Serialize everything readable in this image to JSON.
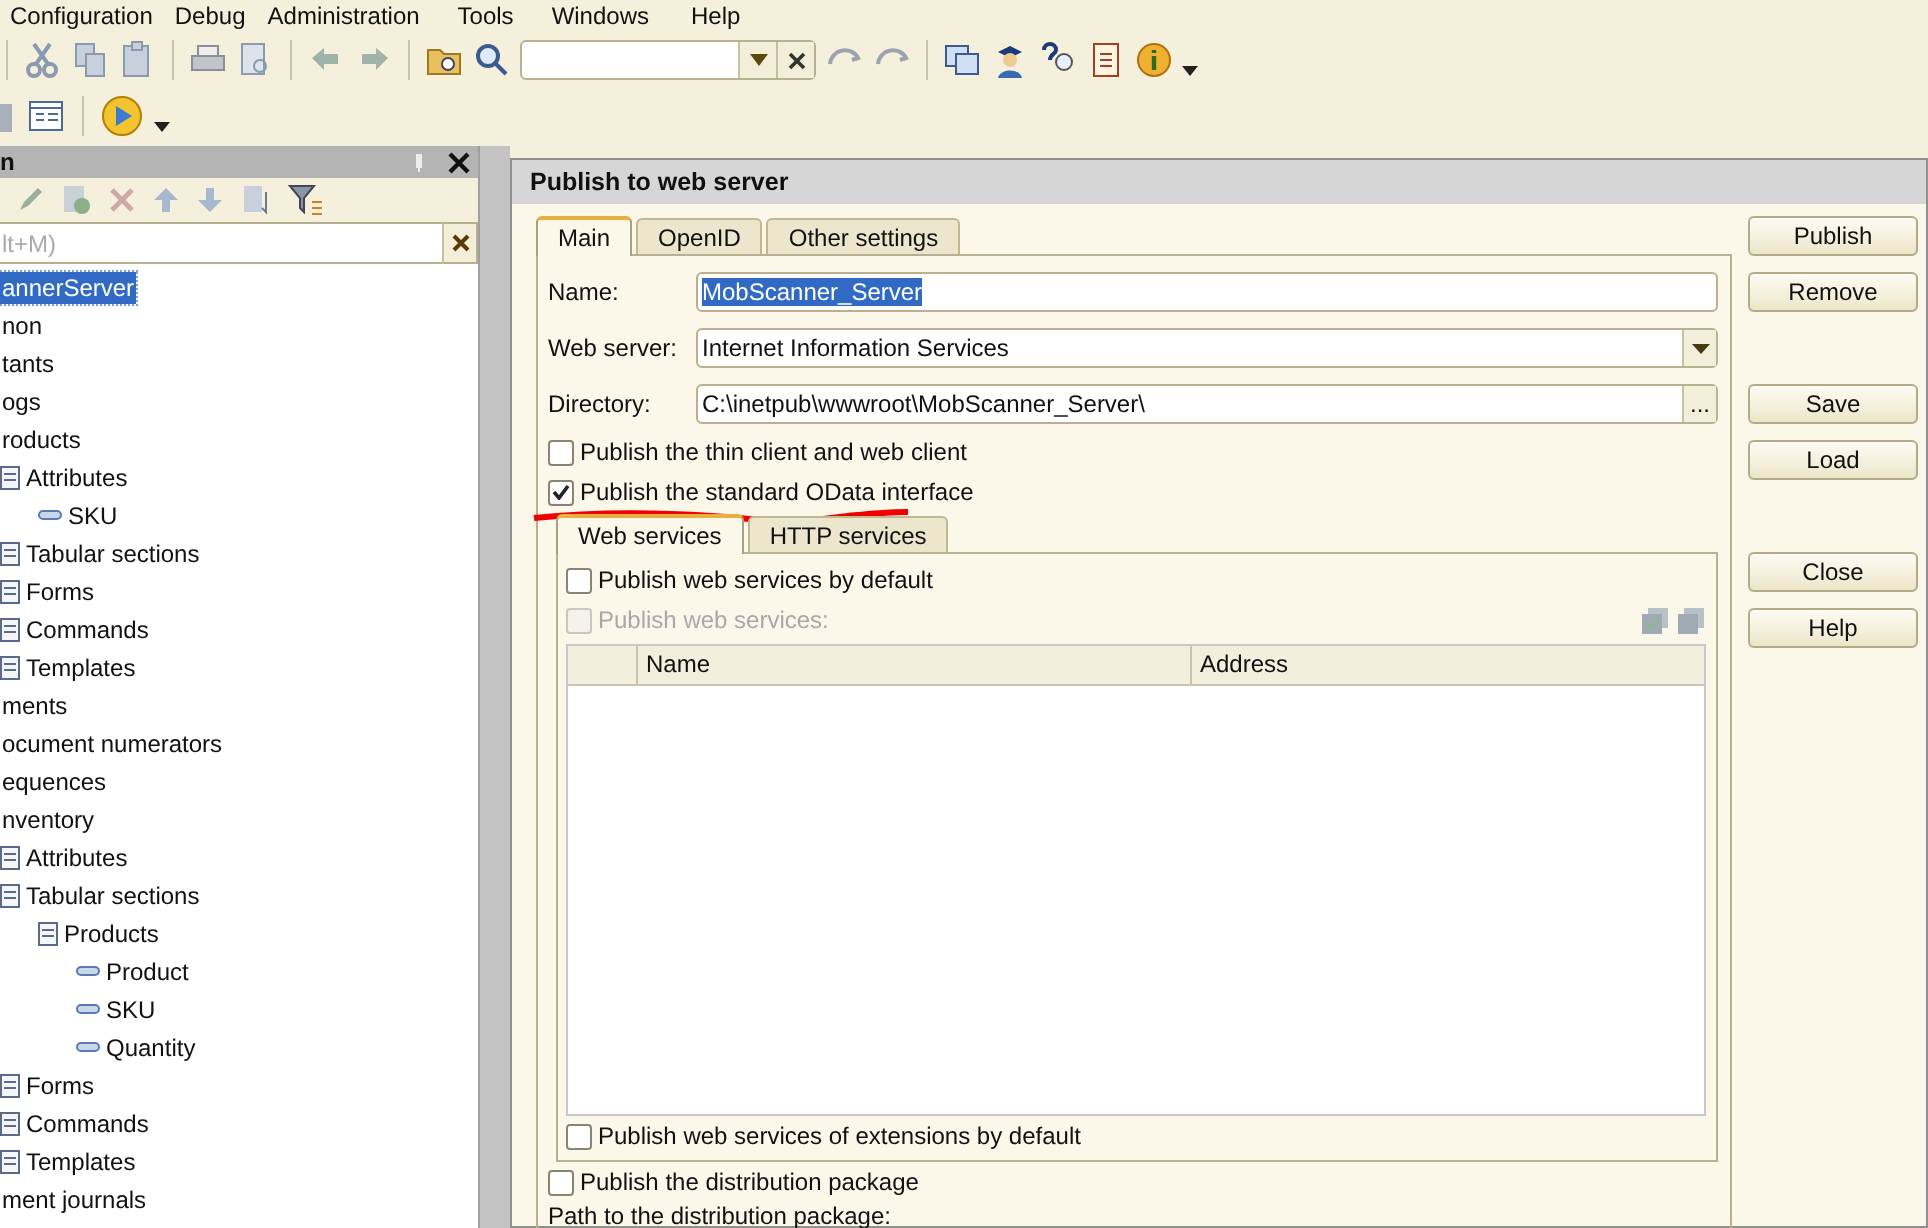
{
  "menu": [
    {
      "label": "Configuration"
    },
    {
      "label": "Debug"
    },
    {
      "label": "Administration"
    },
    {
      "label": "Tools"
    },
    {
      "label": "Windows"
    },
    {
      "label": "Help"
    }
  ],
  "panel": {
    "title": "n",
    "search_placeholder": "lt+M)",
    "tree": [
      {
        "label": "annerServer",
        "selected": true
      },
      {
        "label": "non",
        "selected": false
      },
      {
        "label": "tants",
        "selected": false
      },
      {
        "label": "ogs",
        "selected": false
      },
      {
        "label": "roducts",
        "selected": false,
        "children": [
          {
            "label": "Attributes",
            "selected": false,
            "children": [
              {
                "label": "SKU",
                "selected": false
              }
            ]
          },
          {
            "label": "Tabular sections",
            "selected": false
          },
          {
            "label": "Forms",
            "selected": false
          },
          {
            "label": "Commands",
            "selected": false
          },
          {
            "label": "Templates",
            "selected": false
          }
        ]
      },
      {
        "label": "ments",
        "selected": false
      },
      {
        "label": "ocument numerators",
        "selected": false
      },
      {
        "label": "equences",
        "selected": false
      },
      {
        "label": "nventory",
        "selected": false,
        "children": [
          {
            "label": "Attributes",
            "selected": false
          },
          {
            "label": "Tabular sections",
            "selected": false,
            "children": [
              {
                "label": "Products",
                "selected": false,
                "children": [
                  {
                    "label": "Product",
                    "selected": false
                  },
                  {
                    "label": "SKU",
                    "selected": false
                  },
                  {
                    "label": "Quantity",
                    "selected": false
                  }
                ]
              }
            ]
          },
          {
            "label": "Forms",
            "selected": false
          },
          {
            "label": "Commands",
            "selected": false
          },
          {
            "label": "Templates",
            "selected": false
          }
        ]
      },
      {
        "label": "ment journals",
        "selected": false
      }
    ]
  },
  "dialog": {
    "title": "Publish to web server",
    "tabs": [
      {
        "label": "Main",
        "selected": true
      },
      {
        "label": "OpenID",
        "selected": false
      },
      {
        "label": "Other settings",
        "selected": false
      }
    ],
    "fields": [
      {
        "label": "Name:",
        "value": "MobScanner_Server",
        "text_selected": true,
        "kind": "text"
      },
      {
        "label": "Web server:",
        "value": "Internet Information Services",
        "text_selected": false,
        "kind": "dropdown"
      },
      {
        "label": "Directory:",
        "value": "C:\\inetpub\\wwwroot\\MobScanner_Server\\",
        "text_selected": false,
        "kind": "browse"
      }
    ],
    "browse_label": "...",
    "checkboxes": [
      {
        "label": "Publish the thin client and web client",
        "checked": false
      },
      {
        "label": "Publish the standard OData interface",
        "checked": true
      }
    ],
    "web_services": {
      "tabs": [
        {
          "label": "Web services",
          "selected": true
        },
        {
          "label": "HTTP services",
          "selected": false
        }
      ],
      "checkboxes": [
        {
          "label": "Publish web services by default",
          "checked": false,
          "disabled": false
        },
        {
          "label": "Publish web services:",
          "checked": false,
          "disabled": true
        }
      ],
      "columns": [
        {
          "label": "Name"
        },
        {
          "label": "Address"
        }
      ],
      "bottom_checkbox": {
        "label": "Publish web services of extensions by default",
        "checked": false
      }
    },
    "distribution_checkbox": {
      "label": "Publish the distribution package",
      "checked": false
    },
    "path_label": "Path to the distribution package:",
    "buttons": [
      [
        {
          "label": "Publish"
        },
        {
          "label": "Remove"
        }
      ],
      [
        {
          "label": "Save"
        },
        {
          "label": "Load"
        }
      ],
      [
        {
          "label": "Close"
        },
        {
          "label": "Help"
        }
      ]
    ]
  }
}
